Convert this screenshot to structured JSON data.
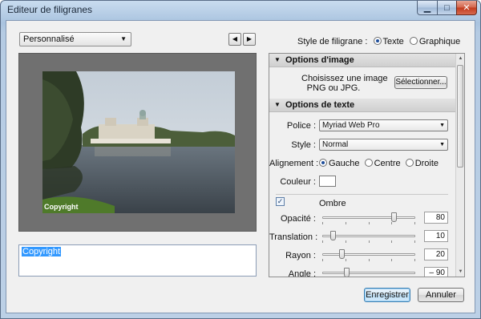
{
  "window": {
    "title": "Editeur de filigranes"
  },
  "preset": {
    "selected": "Personnalisé"
  },
  "watermark_style": {
    "label": "Style de filigrane :",
    "options": [
      "Texte",
      "Graphique"
    ],
    "selected": "Texte"
  },
  "preview": {
    "watermark_text": "Copyright"
  },
  "text_input": {
    "value": "Copyright"
  },
  "panel": {
    "image_options": {
      "title": "Options d'image",
      "hint_line1": "Choisissez une image",
      "hint_line2": "PNG ou JPG.",
      "select_button": "Sélectionner..."
    },
    "text_options": {
      "title": "Options de texte",
      "font_label": "Police :",
      "font_value": "Myriad Web Pro",
      "style_label": "Style :",
      "style_value": "Normal",
      "alignment_label": "Alignement :",
      "alignment_options": [
        "Gauche",
        "Centre",
        "Droite"
      ],
      "alignment_selected": "Gauche",
      "color_label": "Couleur :",
      "color_value": "#ffffff",
      "shadow": {
        "label": "Ombre",
        "checked": true,
        "opacity_label": "Opacité :",
        "opacity_value": "80",
        "opacity": 80,
        "offset_label": "Translation :",
        "offset_value": "10",
        "offset": 10,
        "radius_label": "Rayon :",
        "radius_value": "20",
        "radius": 20,
        "angle_label": "Angle :",
        "angle_value": "– 90",
        "angle": -90
      }
    }
  },
  "buttons": {
    "save": "Enregistrer",
    "cancel": "Annuler"
  }
}
